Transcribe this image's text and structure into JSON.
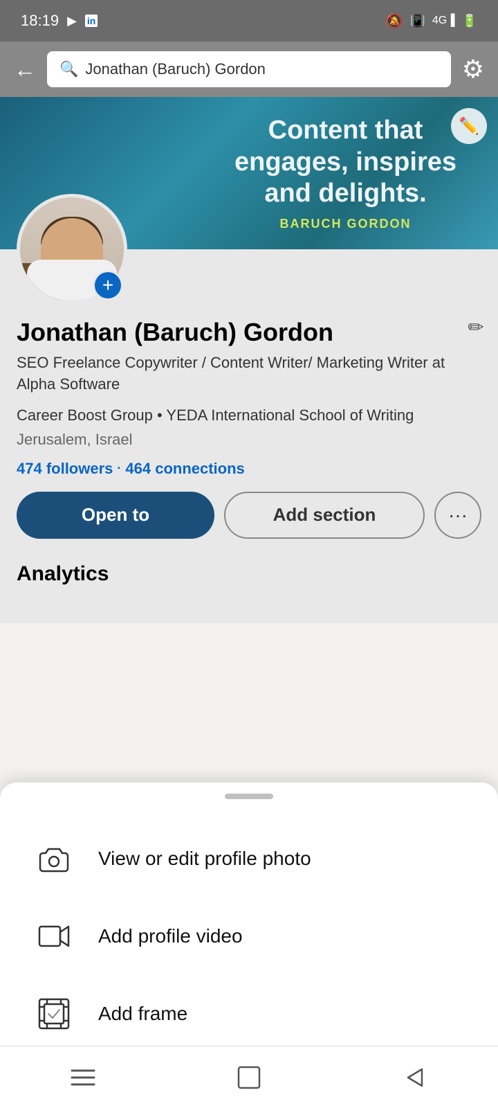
{
  "status_bar": {
    "time": "18:19",
    "icons_left": [
      "youtube-icon",
      "linkedin-icon"
    ],
    "icons_right": [
      "notification-icon",
      "vibrate-icon",
      "signal-icon",
      "battery-icon"
    ]
  },
  "search_bar": {
    "back_label": "←",
    "search_query": "Jonathan (Baruch) Gordon",
    "settings_label": "⚙"
  },
  "banner": {
    "headline": "Content that\nengages, inspires\nand delights.",
    "headline_line1": "Content that",
    "headline_line2": "engages, inspires",
    "headline_line3": "and delights.",
    "byline": "BARUCH GORDON"
  },
  "profile": {
    "name": "Jonathan (Baruch) Gordon",
    "title": "SEO Freelance Copywriter / Content Writer/ Marketing Writer at Alpha Software",
    "education": "Career Boost Group • YEDA International School of Writing",
    "location": "Jerusalem, Israel",
    "followers": "474 followers",
    "connections": "464 connections",
    "dot_separator": "·"
  },
  "action_buttons": {
    "open_to": "Open to",
    "add_section": "Add section",
    "more": "···"
  },
  "analytics": {
    "title": "Analytics"
  },
  "bottom_sheet": {
    "handle_label": "",
    "items": [
      {
        "id": "view-edit-photo",
        "icon": "camera-icon",
        "label": "View or edit profile photo"
      },
      {
        "id": "add-video",
        "icon": "video-icon",
        "label": "Add profile video"
      },
      {
        "id": "add-frame",
        "icon": "frame-icon",
        "label": "Add frame"
      }
    ]
  },
  "nav_bar": {
    "items": [
      {
        "id": "menu-icon",
        "symbol": "☰"
      },
      {
        "id": "home-icon",
        "symbol": "□"
      },
      {
        "id": "back-icon",
        "symbol": "◁"
      }
    ]
  }
}
